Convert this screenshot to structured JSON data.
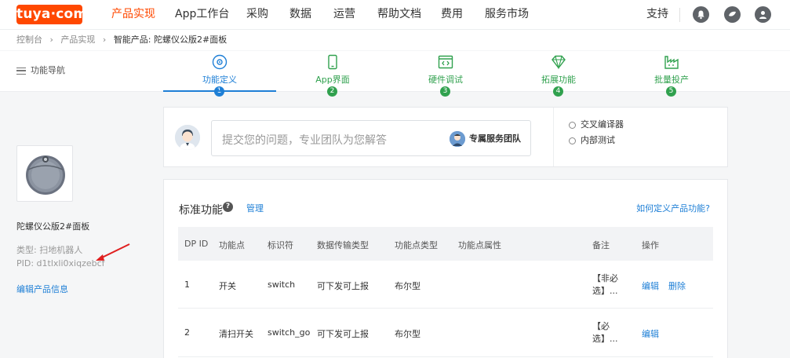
{
  "logo": {
    "text": "tuya·com"
  },
  "nav": {
    "items": [
      "产品实现",
      "App工作台",
      "采购",
      "数据",
      "运营",
      "帮助文档",
      "费用",
      "服务市场"
    ],
    "support": "支持"
  },
  "breadcrumb": {
    "items": [
      "控制台",
      "›",
      "产品实现",
      "›"
    ],
    "current": "智能产品: 陀螺仪公版2#面板"
  },
  "stepbar": {
    "func_nav": "功能导航",
    "steps": [
      {
        "label": "功能定义",
        "num": "1",
        "icon": "gear-circle-icon"
      },
      {
        "label": "App界面",
        "num": "2",
        "icon": "phone-icon"
      },
      {
        "label": "硬件调试",
        "num": "3",
        "icon": "code-window-icon"
      },
      {
        "label": "拓展功能",
        "num": "4",
        "icon": "diamond-icon"
      },
      {
        "label": "批量投产",
        "num": "5",
        "icon": "factory-icon"
      }
    ]
  },
  "sidebar": {
    "product_name": "陀螺仪公版2#面板",
    "type": "类型: 扫地机器人",
    "pid": "PID: d1tlxli0xiqzebcf",
    "edit": "编辑产品信息"
  },
  "help": {
    "placeholder": "提交您的问题，专业团队为您解答",
    "team": "专属服务团队",
    "tools": [
      "交叉编译器",
      "内部测试"
    ]
  },
  "functions": {
    "title": "标准功能",
    "manage": "管理",
    "how_link": "如何定义产品功能?",
    "headers": [
      "DP ID",
      "功能点",
      "标识符",
      "数据传输类型",
      "功能点类型",
      "功能点属性",
      "备注",
      "操作"
    ],
    "rows": [
      {
        "dpid": "1",
        "name": "开关",
        "code": "switch",
        "transfer": "可下发可上报",
        "type": "布尔型",
        "note1": "【非必",
        "note2": "选】...",
        "edit": "编辑",
        "delete": "删除"
      },
      {
        "dpid": "2",
        "name": "清扫开关",
        "code": "switch_go",
        "transfer": "可下发可上报",
        "type": "布尔型",
        "note1": "【必",
        "note2": "选】...",
        "edit": "编辑",
        "delete": ""
      }
    ]
  },
  "colors": {
    "brand": "#ff4800",
    "accent": "#1e7fd6",
    "done": "#30a14e"
  }
}
